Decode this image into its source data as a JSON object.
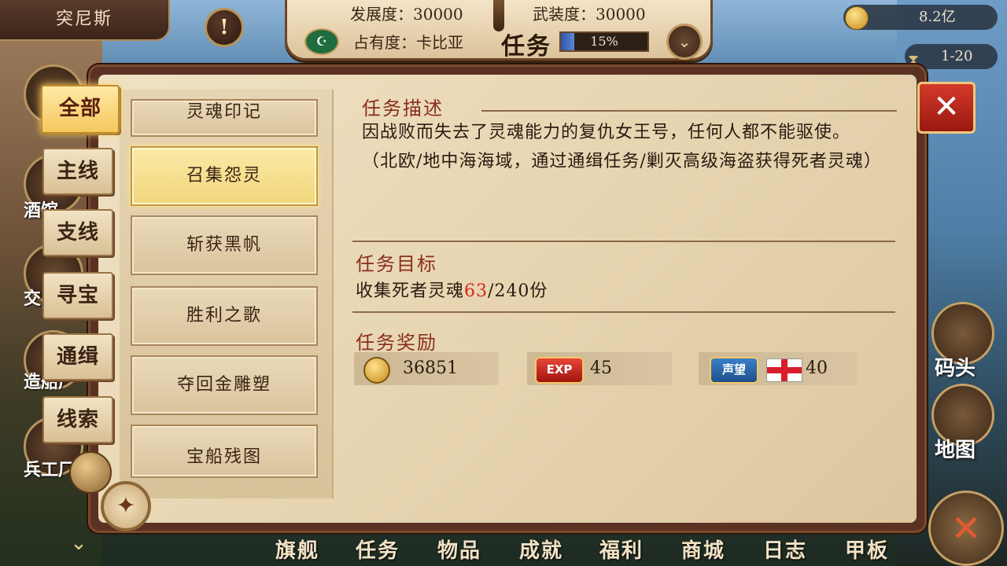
{
  "top": {
    "city_name": "突尼斯",
    "alert_icon": "exclamation-icon",
    "development_label": "发展度：",
    "development_value": "30000",
    "armament_label": "武装度：",
    "armament_value": "30000",
    "occupy_text": "占有度：卡比亚",
    "task_title": "任务",
    "progress_text": "15%",
    "progress_fraction": 0.15
  },
  "resources": {
    "gold": "8.2亿",
    "time": "1-20"
  },
  "categories": [
    {
      "label": "全部",
      "active": true
    },
    {
      "label": "主线",
      "active": false
    },
    {
      "label": "支线",
      "active": false
    },
    {
      "label": "寻宝",
      "active": false
    },
    {
      "label": "通缉",
      "active": false
    },
    {
      "label": "线索",
      "active": false
    }
  ],
  "quests": [
    {
      "label": "灵魂印记"
    },
    {
      "label": "召集怨灵",
      "selected": true
    },
    {
      "label": "斩获黑帆"
    },
    {
      "label": "胜利之歌"
    },
    {
      "label": "夺回金雕塑"
    },
    {
      "label": "宝船残图"
    }
  ],
  "detail": {
    "description_title": "任务描述",
    "description": "因战败而失去了灵魂能力的复仇女王号，任何人都不能驱使。（北欧/地中海海域，通过通缉任务/剿灭高级海盗获得死者灵魂）",
    "objective_title": "任务目标",
    "objective_prefix": "收集死者灵魂",
    "objective_current": "63",
    "objective_suffix": "/240份",
    "reward_title": "任务奖励",
    "rewards": [
      {
        "icon": "gold-coin-icon",
        "value": "36851"
      },
      {
        "icon": "exp-badge-icon",
        "badge": "EXP",
        "value": "45"
      },
      {
        "icon": "reputation-badge-icon",
        "badge": "声望",
        "value": "40"
      }
    ]
  },
  "side_buttons": {
    "dock": "码头",
    "map": "地图"
  },
  "town_labels": [
    "酒馆",
    "交",
    "造船厂",
    "兵工厂"
  ],
  "bottom_nav": [
    "旗舰",
    "任务",
    "物品",
    "成就",
    "福利",
    "商城",
    "日志",
    "甲板"
  ],
  "colors": {
    "accent_red": "#8a2e1c",
    "progress_blue": "#2d56a8",
    "highlight_red": "#d02a1e"
  }
}
